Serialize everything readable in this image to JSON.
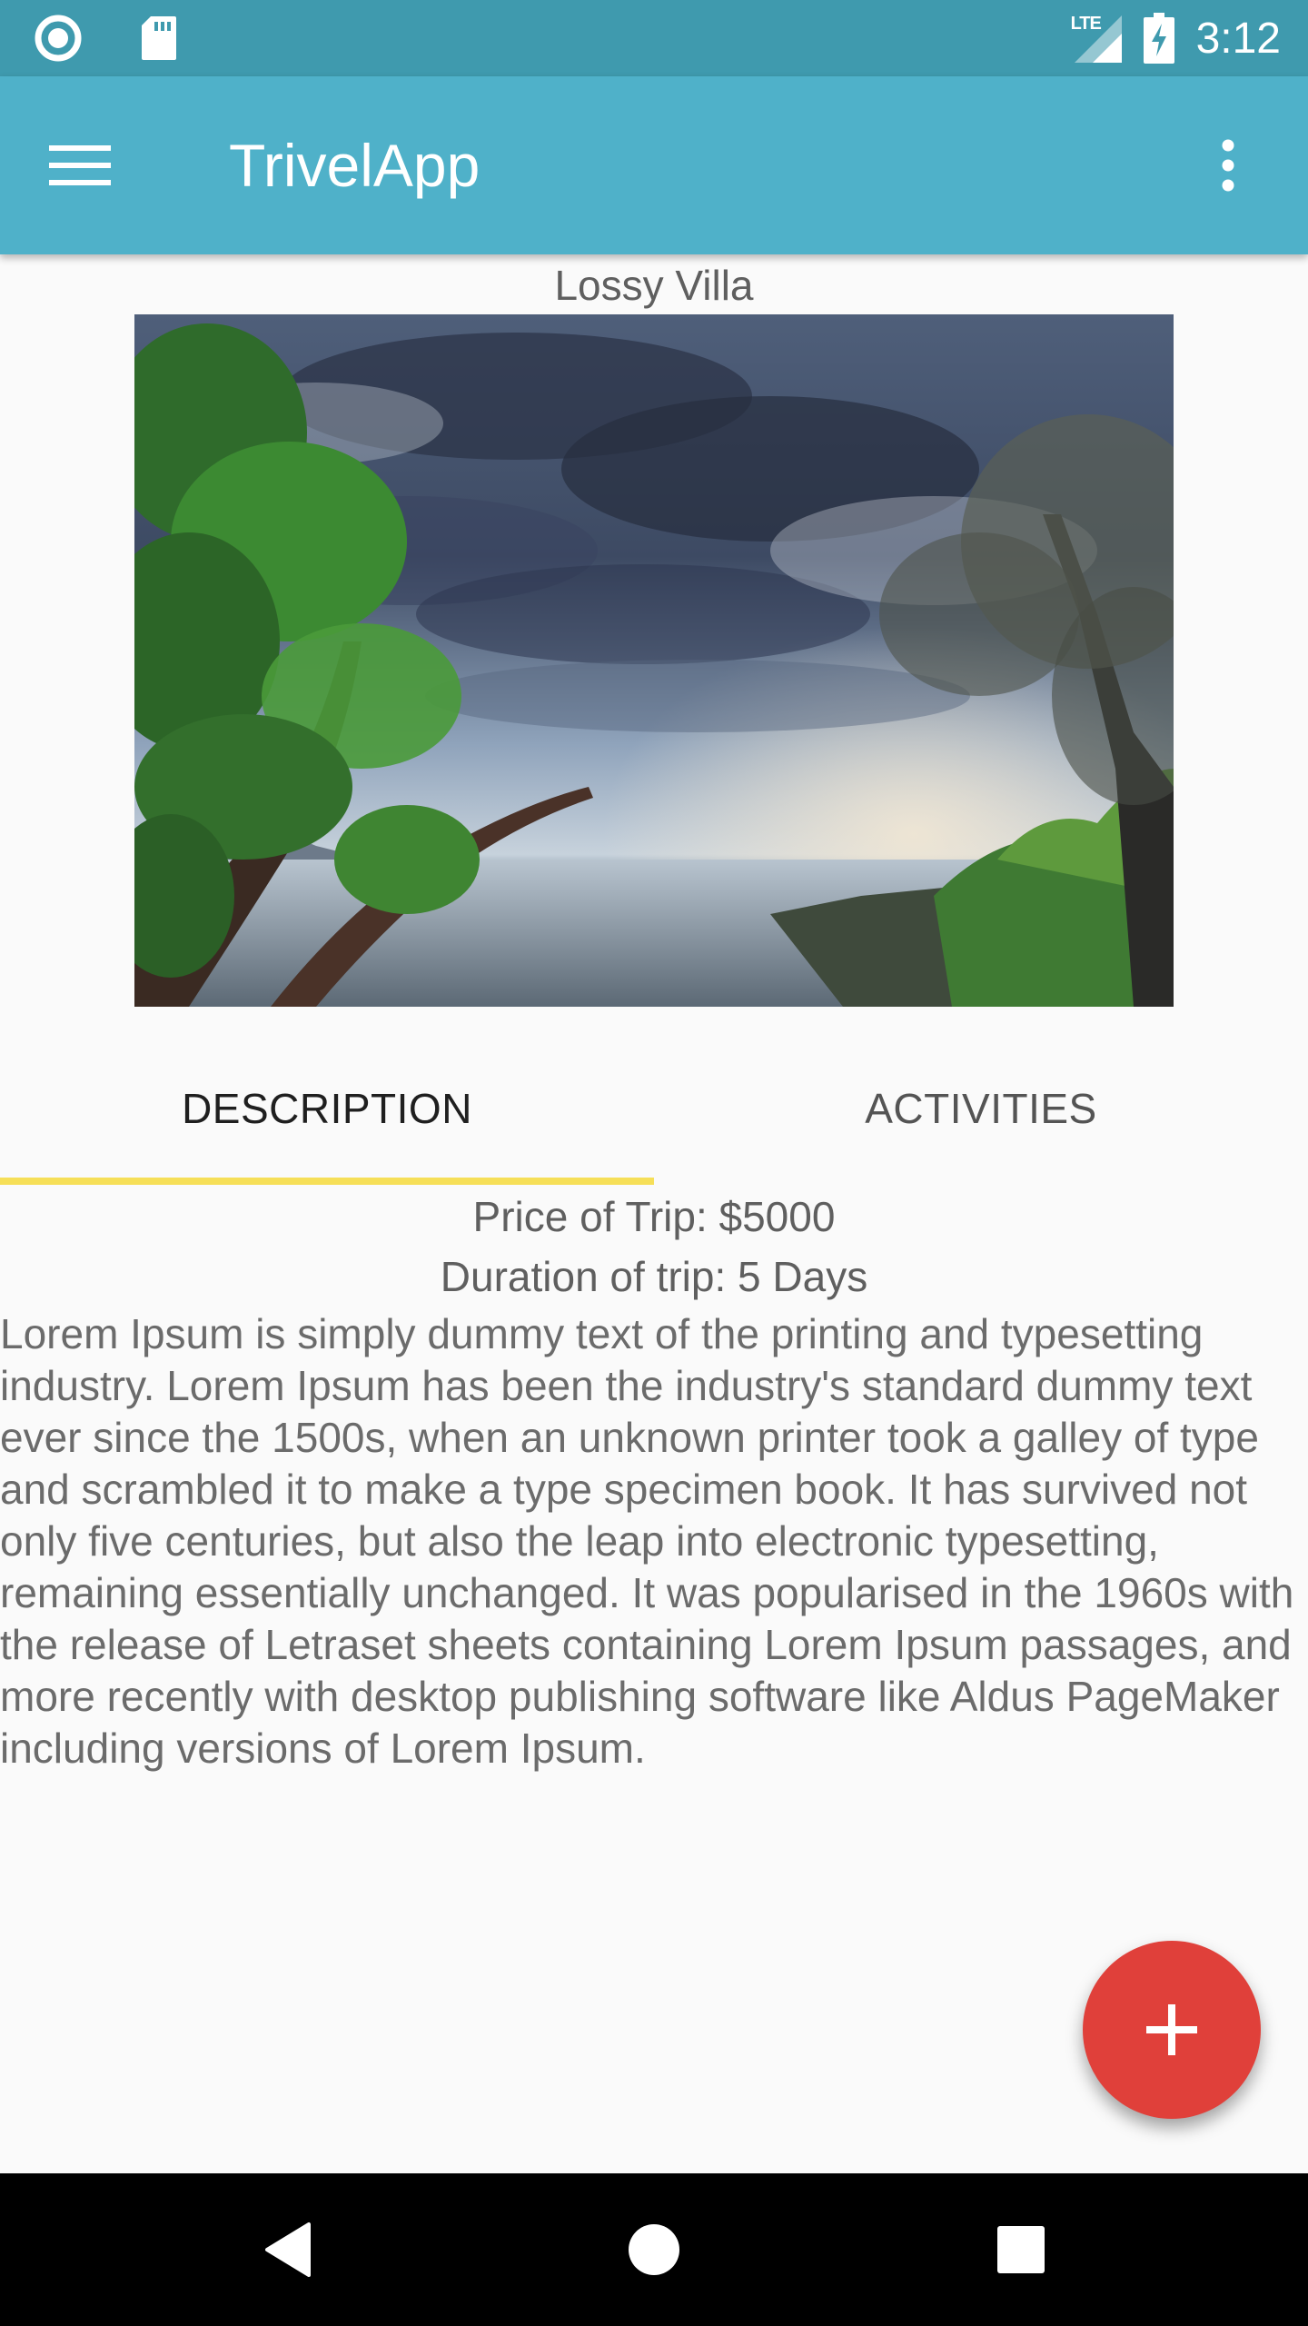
{
  "status_bar": {
    "network": "LTE",
    "time": "3:12"
  },
  "app_bar": {
    "title": "TrivelApp",
    "menu_icon": "hamburger-menu-icon",
    "overflow_icon": "more-vert-icon",
    "color": "#4fb1c9"
  },
  "place": {
    "name": "Lossy Villa",
    "image_subject": "coastal-landscape-photo"
  },
  "tabs": [
    {
      "label": "DESCRIPTION",
      "selected": true
    },
    {
      "label": "ACTIVITIES",
      "selected": false
    }
  ],
  "trip": {
    "price": "Price of Trip: $5000",
    "duration": "Duration of trip: 5 Days",
    "description": "Lorem Ipsum is simply dummy text of the printing and typesetting industry. Lorem Ipsum has been the industry's standard dummy text ever since the 1500s, when an unknown printer took a galley of type and scrambled it to make a type specimen book. It has survived not only five centuries, but also the leap into electronic typesetting, remaining essentially unchanged. It was popularised in the 1960s with the release of Letraset sheets containing Lorem Ipsum passages, and more recently with desktop publishing software like Aldus PageMaker including versions of Lorem Ipsum."
  },
  "fab": {
    "icon": "plus-icon",
    "color": "#e0403a"
  },
  "colors": {
    "status_bar": "#3f9aae",
    "tab_indicator": "#f6df58",
    "nav_bar": "#000000"
  }
}
